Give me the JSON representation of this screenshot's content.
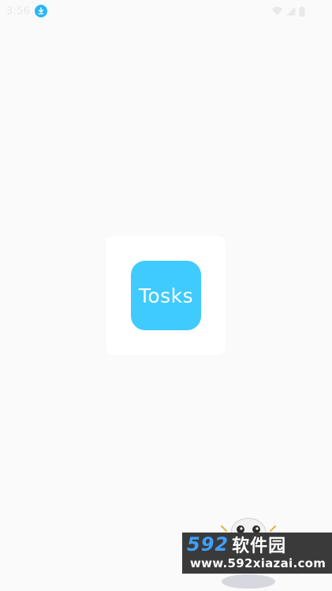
{
  "status_bar": {
    "time": "3:56",
    "notification_icon": "download-icon",
    "system_icons": [
      "wifi-icon",
      "cell-signal-icon",
      "battery-icon"
    ]
  },
  "splash": {
    "app_name": "Tosks",
    "icon_color": "#3fcbfd",
    "card_color": "#ffffff",
    "background_color": "#fafafa"
  },
  "watermark": {
    "brand_digits": "592",
    "brand_cn": "软件园",
    "url": "www.592xiazai.com"
  }
}
